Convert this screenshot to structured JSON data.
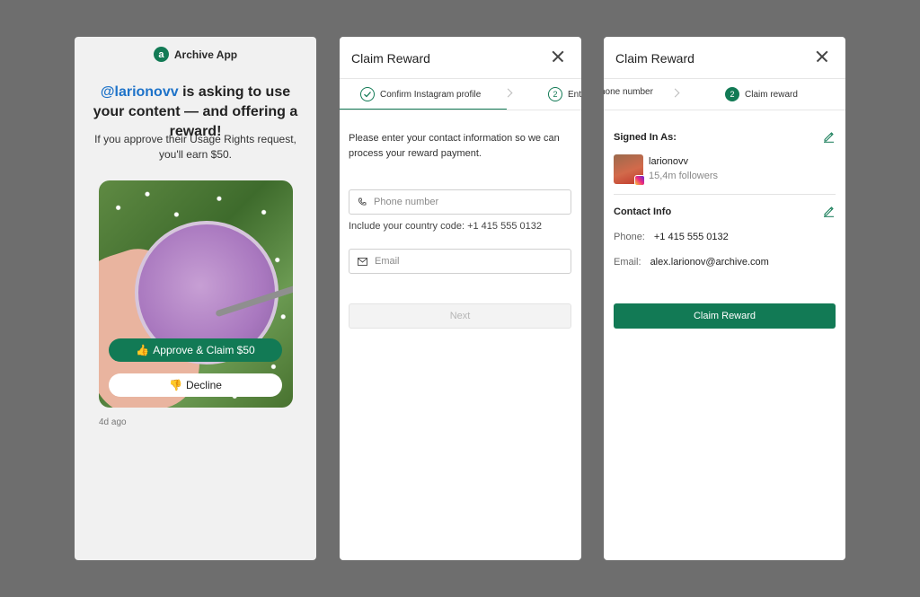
{
  "colors": {
    "accent": "#127a55",
    "handle": "#1e73c9",
    "backdrop": "#6e6e6e"
  },
  "notification": {
    "brand_logo": "a",
    "brand_name": "Archive App",
    "handle": "@larionovv",
    "headline_rest": " is asking to use your content — and offering a reward!",
    "subtext": "If you approve their Usage Rights request, you'll earn $50.",
    "approve_emoji": "👍",
    "approve_label": "Approve & Claim $50",
    "decline_emoji": "👎",
    "decline_label": "Decline",
    "timestamp": "4d ago"
  },
  "modal_step1": {
    "title": "Claim Reward",
    "steps": [
      {
        "label": "Confirm Instagram profile",
        "state": "done",
        "icon": "check-icon"
      },
      {
        "number": "2",
        "label": "Enter phone number",
        "state": "active"
      }
    ],
    "instructions": "Please enter your contact information so we can process your reward payment.",
    "phone_placeholder": "Phone number",
    "phone_hint": "Include your country code: +1 415 555 0132",
    "email_placeholder": "Email",
    "next_label": "Next"
  },
  "modal_step2": {
    "title": "Claim Reward",
    "steps": [
      {
        "label": "hone number",
        "state": "done"
      },
      {
        "number": "2",
        "label": "Claim reward",
        "state": "active"
      }
    ],
    "signed_in_title": "Signed In As:",
    "username": "larionovv",
    "followers": "15,4m followers",
    "contact_title": "Contact Info",
    "phone_label": "Phone:",
    "phone_value": "+1 415 555 0132",
    "email_label": "Email:",
    "email_value": "alex.larionov@archive.com",
    "claim_label": "Claim Reward"
  }
}
